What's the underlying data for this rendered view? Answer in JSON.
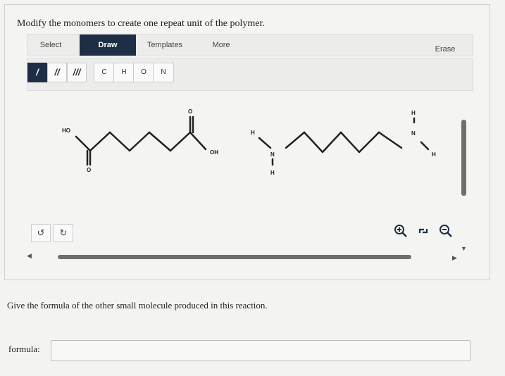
{
  "prompt": "Modify the monomers to create one repeat unit of the polymer.",
  "tabs": [
    {
      "label": "Select"
    },
    {
      "label": "Draw"
    },
    {
      "label": "Templates"
    },
    {
      "label": "More"
    },
    {
      "label": "Erase"
    }
  ],
  "bond_tools": [
    "/",
    "//",
    "///"
  ],
  "atom_tools": [
    "C",
    "H",
    "O",
    "N"
  ],
  "molecule1_labels": {
    "ho": "HO",
    "o_top": "O",
    "o_bottom": "O",
    "oh": "OH"
  },
  "molecule2_labels": {
    "h_left": "H",
    "n_left": "N",
    "n_left_h": "H",
    "h_right_top": "H",
    "n_right": "N",
    "h_right": "H"
  },
  "controls": {
    "undo_icon": "undo-icon",
    "redo_icon": "redo-icon",
    "zoom_in_icon": "zoom-in-icon",
    "zoom_reset_icon": "zoom-reset-icon",
    "zoom_out_icon": "zoom-out-icon"
  },
  "question": "Give the formula of the other small molecule produced in this reaction.",
  "formula": {
    "label": "formula:",
    "value": ""
  }
}
